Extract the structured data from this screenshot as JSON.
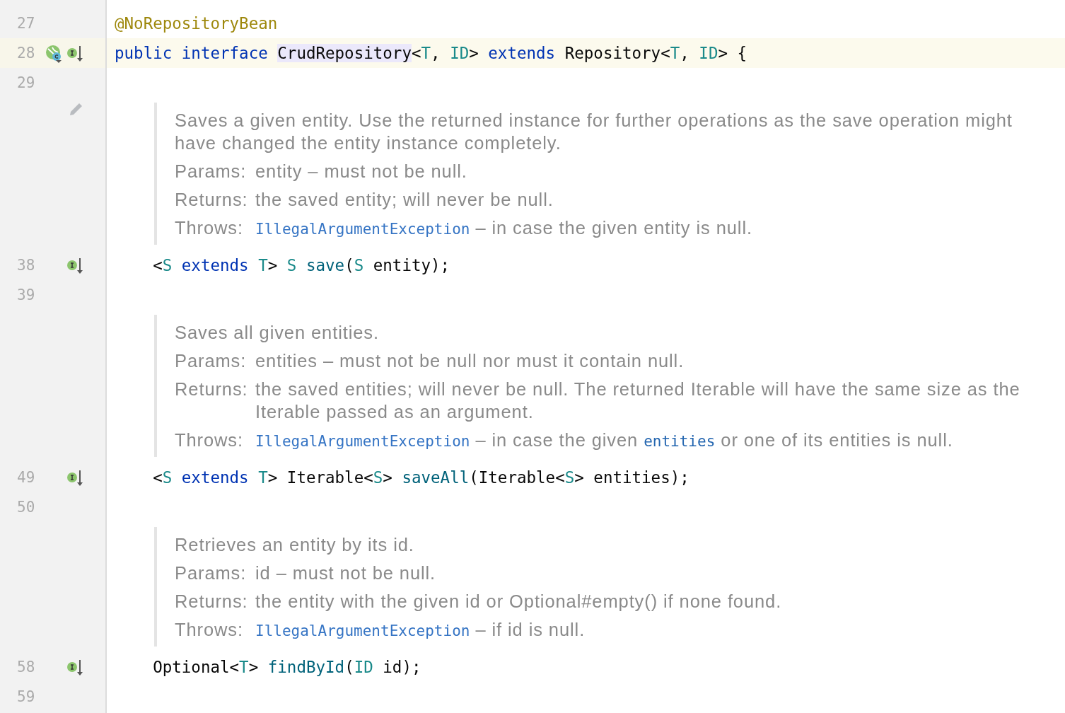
{
  "editor": {
    "lines": [
      {
        "kind": "code",
        "number": "27",
        "current": false,
        "tokens": [
          {
            "text": "@NoRepositoryBean",
            "kind": "annotation"
          }
        ]
      },
      {
        "kind": "code",
        "number": "28",
        "current": true,
        "gutter_icons": [
          {
            "kind": "bean"
          },
          {
            "kind": "implemented"
          }
        ],
        "tokens": [
          {
            "text": "public",
            "kind": "keyword"
          },
          {
            "text": " interface ",
            "kind": "keyword"
          },
          {
            "text": "CrudRepository",
            "kind": "declared"
          },
          {
            "text": "<",
            "kind": "plain"
          },
          {
            "text": "T",
            "kind": "type_param"
          },
          {
            "text": ", ",
            "kind": "plain"
          },
          {
            "text": "ID",
            "kind": "type_param"
          },
          {
            "text": "> ",
            "kind": "plain"
          },
          {
            "text": "extends",
            "kind": "keyword"
          },
          {
            "text": " Repository<",
            "kind": "plain"
          },
          {
            "text": "T",
            "kind": "type_param"
          },
          {
            "text": ", ",
            "kind": "plain"
          },
          {
            "text": "ID",
            "kind": "type_param"
          },
          {
            "text": "> {",
            "kind": "plain"
          }
        ]
      },
      {
        "kind": "code",
        "number": "29",
        "current": false
      },
      {
        "kind": "doc",
        "edit_icon": true,
        "description": "Saves a given entity. Use the returned instance for further operations as the save operation might have changed the entity instance completely.",
        "tags": [
          {
            "label": "Params:",
            "segments": [
              {
                "text": "entity – must not be null.",
                "kind": "text"
              }
            ]
          },
          {
            "label": "Returns:",
            "segments": [
              {
                "text": "the saved entity; will never be null.",
                "kind": "text"
              }
            ]
          },
          {
            "label": "Throws:",
            "segments": [
              {
                "text": "IllegalArgumentException",
                "kind": "link"
              },
              {
                "text": " – in case the given entity is null.",
                "kind": "text"
              }
            ]
          }
        ]
      },
      {
        "kind": "code",
        "number": "38",
        "current": false,
        "gutter_icons": [
          {
            "kind": "implemented"
          }
        ],
        "tokens": [
          {
            "text": "    <",
            "kind": "plain"
          },
          {
            "text": "S",
            "kind": "type_param"
          },
          {
            "text": " extends ",
            "kind": "keyword"
          },
          {
            "text": "T",
            "kind": "type_param"
          },
          {
            "text": "> ",
            "kind": "plain"
          },
          {
            "text": "S",
            "kind": "type_param"
          },
          {
            "text": " save",
            "kind": "method"
          },
          {
            "text": "(",
            "kind": "plain"
          },
          {
            "text": "S",
            "kind": "type_param"
          },
          {
            "text": " entity);",
            "kind": "plain"
          }
        ]
      },
      {
        "kind": "code",
        "number": "39",
        "current": false
      },
      {
        "kind": "doc",
        "edit_icon": false,
        "description": "Saves all given entities.",
        "tags": [
          {
            "label": "Params:",
            "segments": [
              {
                "text": "entities – must not be null nor must it contain null.",
                "kind": "text"
              }
            ]
          },
          {
            "label": "Returns:",
            "segments": [
              {
                "text": "the saved entities; will never be null. The returned Iterable will have the same size as the Iterable passed as an argument.",
                "kind": "text"
              }
            ]
          },
          {
            "label": "Throws:",
            "segments": [
              {
                "text": "IllegalArgumentException",
                "kind": "link"
              },
              {
                "text": " – in case the given ",
                "kind": "text"
              },
              {
                "text": "entities",
                "kind": "code"
              },
              {
                "text": " or one of its entities is null.",
                "kind": "text"
              }
            ]
          }
        ]
      },
      {
        "kind": "code",
        "number": "49",
        "current": false,
        "gutter_icons": [
          {
            "kind": "implemented"
          }
        ],
        "tokens": [
          {
            "text": "    <",
            "kind": "plain"
          },
          {
            "text": "S",
            "kind": "type_param"
          },
          {
            "text": " extends ",
            "kind": "keyword"
          },
          {
            "text": "T",
            "kind": "type_param"
          },
          {
            "text": "> Iterable<",
            "kind": "plain"
          },
          {
            "text": "S",
            "kind": "type_param"
          },
          {
            "text": "> ",
            "kind": "plain"
          },
          {
            "text": "saveAll",
            "kind": "method"
          },
          {
            "text": "(Iterable<",
            "kind": "plain"
          },
          {
            "text": "S",
            "kind": "type_param"
          },
          {
            "text": "> entities);",
            "kind": "plain"
          }
        ]
      },
      {
        "kind": "code",
        "number": "50",
        "current": false
      },
      {
        "kind": "doc",
        "edit_icon": false,
        "description": "Retrieves an entity by its id.",
        "tags": [
          {
            "label": "Params:",
            "segments": [
              {
                "text": "id – must not be null.",
                "kind": "text"
              }
            ]
          },
          {
            "label": "Returns:",
            "segments": [
              {
                "text": "the entity with the given id or Optional#empty() if none found.",
                "kind": "text"
              }
            ]
          },
          {
            "label": "Throws:",
            "segments": [
              {
                "text": "IllegalArgumentException",
                "kind": "link"
              },
              {
                "text": " – if id is null.",
                "kind": "text"
              }
            ]
          }
        ]
      },
      {
        "kind": "code",
        "number": "58",
        "current": false,
        "gutter_icons": [
          {
            "kind": "implemented"
          }
        ],
        "tokens": [
          {
            "text": "    Optional<",
            "kind": "plain"
          },
          {
            "text": "T",
            "kind": "type_param"
          },
          {
            "text": "> ",
            "kind": "plain"
          },
          {
            "text": "findById",
            "kind": "method"
          },
          {
            "text": "(",
            "kind": "plain"
          },
          {
            "text": "ID",
            "kind": "type_param"
          },
          {
            "text": " id);",
            "kind": "plain"
          }
        ]
      },
      {
        "kind": "code",
        "number": "59",
        "current": false
      }
    ]
  }
}
